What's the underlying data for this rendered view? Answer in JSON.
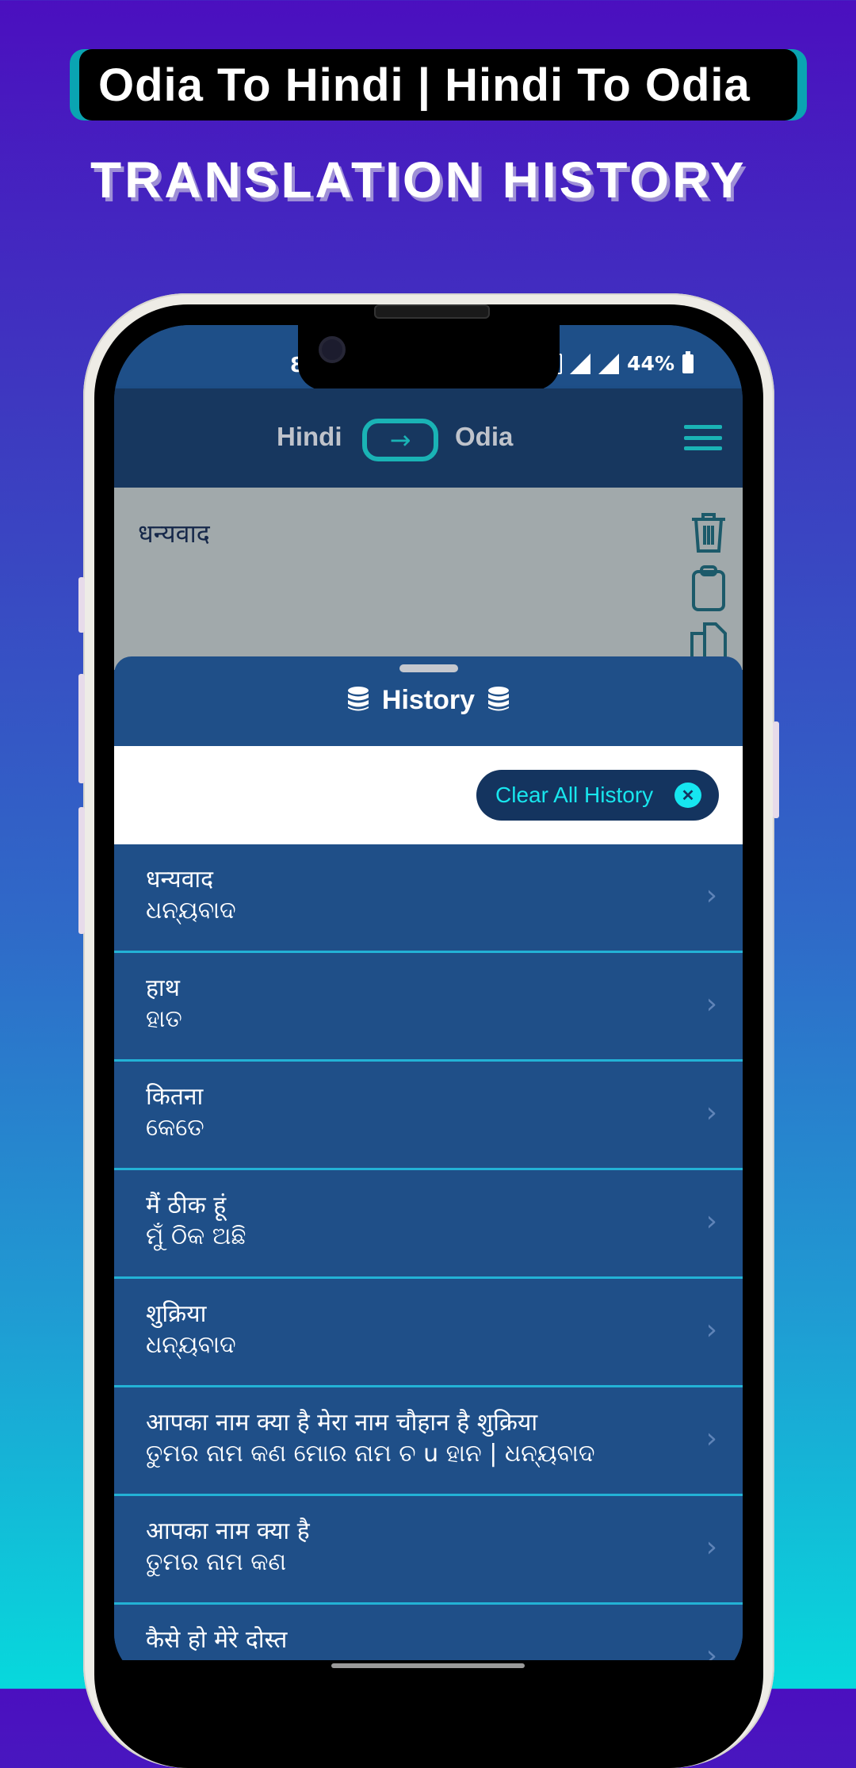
{
  "promo": {
    "banner_title": "Odia To Hindi | Hindi To Odia",
    "headline": "TRANSLATION HISTORY"
  },
  "status_bar": {
    "time_partial": "8.",
    "battery": "44%"
  },
  "app_bar": {
    "source_language": "Hindi",
    "target_language": "Odia",
    "swap_icon": "arrow-right-icon",
    "menu_icon": "hamburger-menu-icon"
  },
  "input": {
    "text": "धन्यवाद",
    "actions": [
      "delete-icon",
      "paste-icon",
      "copy-icon"
    ]
  },
  "history_sheet": {
    "title": "History",
    "title_icon": "database-icon",
    "clear_button_label": "Clear All History",
    "clear_icon": "close-icon",
    "items": [
      {
        "source": "धन्यवाद",
        "translation": "ଧନ୍ୟବାଦ"
      },
      {
        "source": "हाथ",
        "translation": "ହାତ"
      },
      {
        "source": "कितना",
        "translation": "କେତେ"
      },
      {
        "source": "मैं ठीक हूं",
        "translation": "ମୁଁ ଠିକ ଅଛି"
      },
      {
        "source": "शुक्रिया",
        "translation": "ଧନ୍ୟବାଦ"
      },
      {
        "source": "आपका नाम क्या है मेरा नाम चौहान है शुक्रिया",
        "translation": "ତୁମର ନାମ କଣ ମୋର ନାମ ଚ u ହାନ | ଧନ୍ୟବାଦ"
      },
      {
        "source": "आपका नाम क्या है",
        "translation": "ତୁମର ନାମ କଣ"
      },
      {
        "source": "कैसे हो मेरे दोस्त",
        "translation": ""
      }
    ]
  },
  "colors": {
    "accent": "#1ab3b5",
    "app_bar": "#17375f",
    "sheet": "#1f4f88",
    "divider": "#23b2d6",
    "clear_text": "#18e6ee"
  }
}
